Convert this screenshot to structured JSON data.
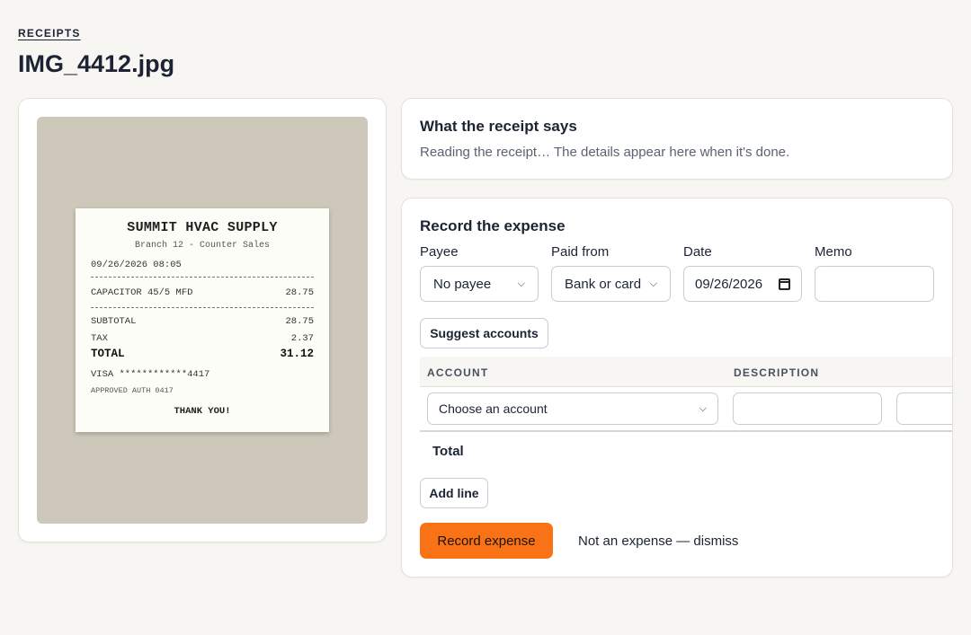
{
  "breadcrumb": "RECEIPTS",
  "page_title": "IMG_4412.jpg",
  "receipt": {
    "store": "SUMMIT HVAC SUPPLY",
    "branch": "Branch 12 - Counter Sales",
    "datetime": "09/26/2026 08:05",
    "item_name": "CAPACITOR 45/5 MFD",
    "item_amount": "28.75",
    "subtotal_label": "SUBTOTAL",
    "subtotal": "28.75",
    "tax_label": "TAX",
    "tax": "2.37",
    "total_label": "TOTAL",
    "total": "31.12",
    "card": "VISA ************4417",
    "approval": "APPROVED AUTH 0417",
    "thanks": "THANK YOU!"
  },
  "summary": {
    "heading": "What the receipt says",
    "status": "Reading the receipt… The details appear here when it's done."
  },
  "form": {
    "heading": "Record the expense",
    "payee_label": "Payee",
    "payee_value": "No payee",
    "paid_from_label": "Paid from",
    "paid_from_value": "Bank or card",
    "date_label": "Date",
    "date_value": "09/26/2026",
    "memo_label": "Memo",
    "memo_value": "",
    "suggest_button": "Suggest accounts",
    "table": {
      "col_account": "ACCOUNT",
      "col_description": "DESCRIPTION",
      "row_account_value": "Choose an account",
      "row_description_value": "",
      "total_label": "Total"
    },
    "add_line_button": "Add line",
    "record_button": "Record expense",
    "dismiss_link": "Not an expense — dismiss"
  },
  "colors": {
    "accent": "#f97316",
    "background": "#f7f6f3",
    "receipt_backdrop": "#cdc8ba"
  }
}
